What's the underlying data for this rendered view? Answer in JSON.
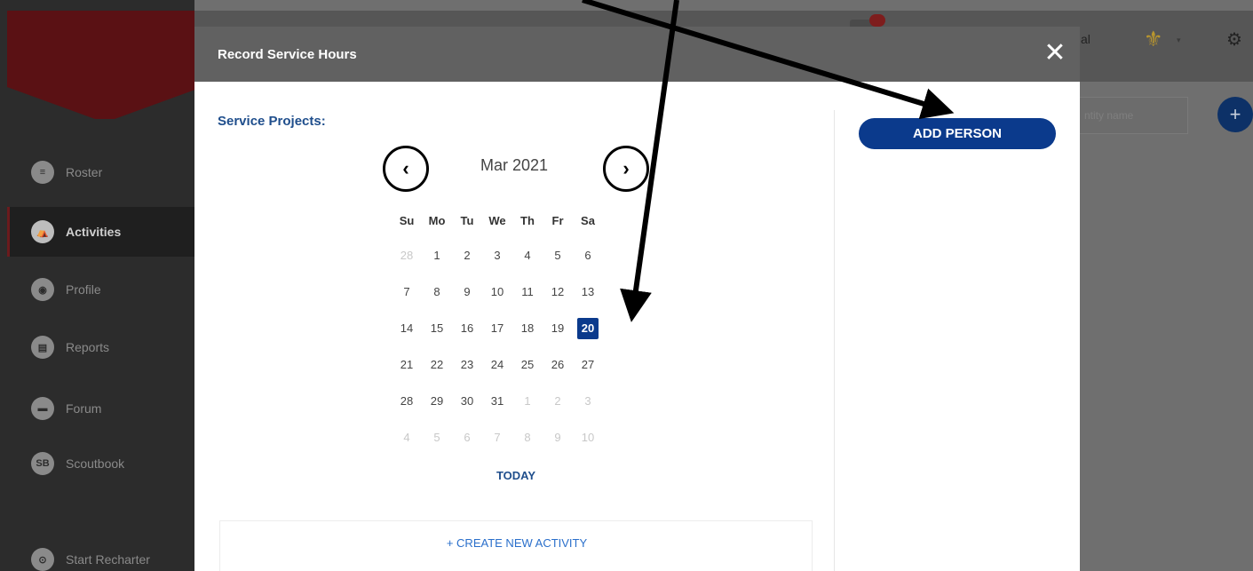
{
  "sidebar": {
    "items": [
      {
        "label": "Roster",
        "icon": "list-icon",
        "glyph": "≡"
      },
      {
        "label": "Activities",
        "icon": "activities-icon",
        "glyph": "⛺"
      },
      {
        "label": "Profile",
        "icon": "profile-icon",
        "glyph": "◉"
      },
      {
        "label": "Reports",
        "icon": "clipboard-icon",
        "glyph": "▤"
      },
      {
        "label": "Forum",
        "icon": "chat-icon",
        "glyph": "▬"
      },
      {
        "label": "Scoutbook",
        "icon": "scoutbook-icon",
        "glyph": "SB"
      },
      {
        "label": "Start Recharter",
        "icon": "recharter-icon",
        "glyph": "⊙"
      }
    ],
    "active_index": 1
  },
  "app_header": {
    "partial_text": "al",
    "fleur_glyph": "⚜",
    "caret_glyph": "▾",
    "gear_glyph": "⚙",
    "search_placeholder": "ntity name",
    "add_glyph": "+"
  },
  "modal": {
    "title": "Record Service Hours",
    "close_glyph": "✕",
    "projects_label": "Service Projects:",
    "add_person_label": "ADD PERSON",
    "create_activity_label": "+ CREATE NEW ACTIVITY"
  },
  "calendar": {
    "month_label": "Mar 2021",
    "prev_glyph": "‹",
    "next_glyph": "›",
    "weekdays": [
      "Su",
      "Mo",
      "Tu",
      "We",
      "Th",
      "Fr",
      "Sa"
    ],
    "weeks": [
      [
        {
          "d": "28",
          "m": true
        },
        {
          "d": "1"
        },
        {
          "d": "2"
        },
        {
          "d": "3"
        },
        {
          "d": "4"
        },
        {
          "d": "5"
        },
        {
          "d": "6"
        }
      ],
      [
        {
          "d": "7"
        },
        {
          "d": "8"
        },
        {
          "d": "9"
        },
        {
          "d": "10"
        },
        {
          "d": "11"
        },
        {
          "d": "12"
        },
        {
          "d": "13"
        }
      ],
      [
        {
          "d": "14"
        },
        {
          "d": "15"
        },
        {
          "d": "16"
        },
        {
          "d": "17"
        },
        {
          "d": "18"
        },
        {
          "d": "19"
        },
        {
          "d": "20",
          "sel": true
        }
      ],
      [
        {
          "d": "21"
        },
        {
          "d": "22"
        },
        {
          "d": "23"
        },
        {
          "d": "24"
        },
        {
          "d": "25"
        },
        {
          "d": "26"
        },
        {
          "d": "27"
        }
      ],
      [
        {
          "d": "28"
        },
        {
          "d": "29"
        },
        {
          "d": "30"
        },
        {
          "d": "31"
        },
        {
          "d": "1",
          "m": true
        },
        {
          "d": "2",
          "m": true
        },
        {
          "d": "3",
          "m": true
        }
      ],
      [
        {
          "d": "4",
          "m": true
        },
        {
          "d": "5",
          "m": true
        },
        {
          "d": "6",
          "m": true
        },
        {
          "d": "7",
          "m": true
        },
        {
          "d": "8",
          "m": true
        },
        {
          "d": "9",
          "m": true
        },
        {
          "d": "10",
          "m": true
        }
      ]
    ],
    "today_label": "TODAY"
  },
  "colors": {
    "accent": "#0b3a8c",
    "link": "#2a6fcb",
    "sidebar": "#2c2c2c",
    "banner": "#5a1114"
  }
}
